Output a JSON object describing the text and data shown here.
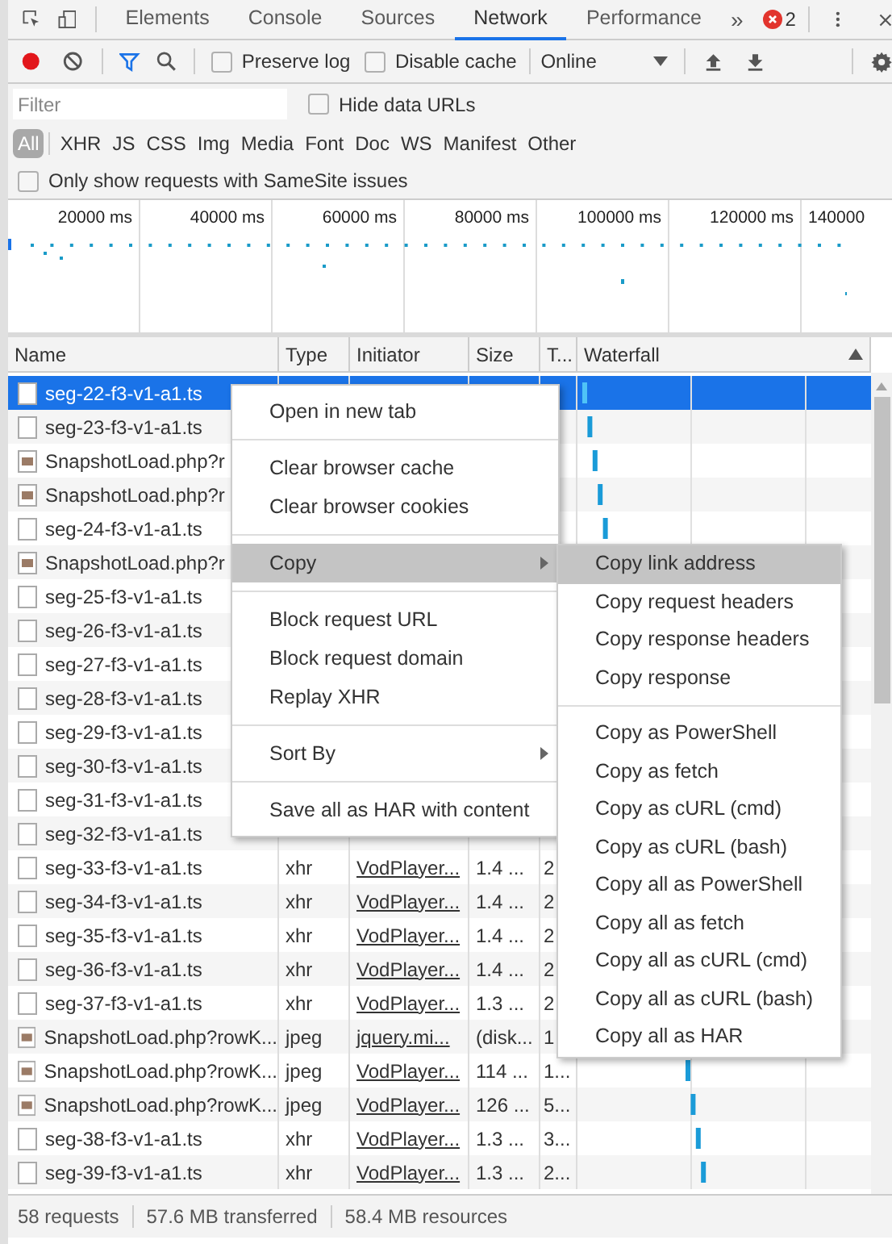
{
  "tabs": [
    {
      "label": "Elements",
      "selected": false
    },
    {
      "label": "Console",
      "selected": false
    },
    {
      "label": "Sources",
      "selected": false
    },
    {
      "label": "Network",
      "selected": true
    },
    {
      "label": "Performance",
      "selected": false
    }
  ],
  "more_tabs": "»",
  "error_count": "2",
  "toolbar": {
    "recording": true,
    "preserve_log": {
      "label": "Preserve log",
      "checked": false
    },
    "disable_cache": {
      "label": "Disable cache",
      "checked": false
    },
    "throttling": "Online"
  },
  "filter": {
    "placeholder": "Filter",
    "hide_data_urls": {
      "label": "Hide data URLs",
      "checked": false
    }
  },
  "type_filters": [
    {
      "label": "All",
      "selected": true
    },
    {
      "label": "XHR",
      "selected": false
    },
    {
      "label": "JS",
      "selected": false
    },
    {
      "label": "CSS",
      "selected": false
    },
    {
      "label": "Img",
      "selected": false
    },
    {
      "label": "Media",
      "selected": false
    },
    {
      "label": "Font",
      "selected": false
    },
    {
      "label": "Doc",
      "selected": false
    },
    {
      "label": "WS",
      "selected": false
    },
    {
      "label": "Manifest",
      "selected": false
    },
    {
      "label": "Other",
      "selected": false
    }
  ],
  "samesite": {
    "label": "Only show requests with SameSite issues",
    "checked": false
  },
  "timeline_ticks": [
    "20000 ms",
    "40000 ms",
    "60000 ms",
    "80000 ms",
    "100000 ms",
    "120000 ms",
    "140000"
  ],
  "columns": [
    "Name",
    "Type",
    "Initiator",
    "Size",
    "T...",
    "Waterfall"
  ],
  "rows": [
    {
      "name": "seg-22-f3-v1-a1.ts",
      "kind": "doc",
      "selected": true,
      "waterfall": true
    },
    {
      "name": "seg-23-f3-v1-a1.ts",
      "kind": "doc",
      "selected": false,
      "waterfall": true
    },
    {
      "name": "SnapshotLoad.php?r",
      "kind": "image",
      "selected": false,
      "waterfall": true
    },
    {
      "name": "SnapshotLoad.php?r",
      "kind": "image",
      "selected": false,
      "waterfall": true
    },
    {
      "name": "seg-24-f3-v1-a1.ts",
      "kind": "doc",
      "selected": false,
      "waterfall": true
    },
    {
      "name": "SnapshotLoad.php?r",
      "kind": "image",
      "selected": false,
      "waterfall": false
    },
    {
      "name": "seg-25-f3-v1-a1.ts",
      "kind": "doc",
      "selected": false,
      "waterfall": false
    },
    {
      "name": "seg-26-f3-v1-a1.ts",
      "kind": "doc",
      "selected": false,
      "waterfall": false
    },
    {
      "name": "seg-27-f3-v1-a1.ts",
      "kind": "doc",
      "selected": false,
      "waterfall": false
    },
    {
      "name": "seg-28-f3-v1-a1.ts",
      "kind": "doc",
      "selected": false,
      "waterfall": false
    },
    {
      "name": "seg-29-f3-v1-a1.ts",
      "kind": "doc",
      "selected": false,
      "waterfall": false
    },
    {
      "name": "seg-30-f3-v1-a1.ts",
      "kind": "doc",
      "selected": false,
      "waterfall": false
    },
    {
      "name": "seg-31-f3-v1-a1.ts",
      "kind": "doc",
      "selected": false,
      "waterfall": false
    },
    {
      "name": "seg-32-f3-v1-a1.ts",
      "kind": "doc",
      "selected": false,
      "waterfall": false
    },
    {
      "name": "seg-33-f3-v1-a1.ts",
      "type": "xhr",
      "initiator": "VodPlayer...",
      "size": "1.4 ...",
      "time": "2",
      "kind": "doc",
      "selected": false,
      "waterfall": false
    },
    {
      "name": "seg-34-f3-v1-a1.ts",
      "type": "xhr",
      "initiator": "VodPlayer...",
      "size": "1.4 ...",
      "time": "2",
      "kind": "doc",
      "selected": false,
      "waterfall": false
    },
    {
      "name": "seg-35-f3-v1-a1.ts",
      "type": "xhr",
      "initiator": "VodPlayer...",
      "size": "1.4 ...",
      "time": "2",
      "kind": "doc",
      "selected": false,
      "waterfall": false
    },
    {
      "name": "seg-36-f3-v1-a1.ts",
      "type": "xhr",
      "initiator": "VodPlayer...",
      "size": "1.4 ...",
      "time": "2",
      "kind": "doc",
      "selected": false,
      "waterfall": false
    },
    {
      "name": "seg-37-f3-v1-a1.ts",
      "type": "xhr",
      "initiator": "VodPlayer...",
      "size": "1.3 ...",
      "time": "2",
      "kind": "doc",
      "selected": false,
      "waterfall": false
    },
    {
      "name": "SnapshotLoad.php?rowK...",
      "type": "jpeg",
      "initiator": "jquery.mi...",
      "size": "(disk...",
      "time": "1",
      "kind": "image",
      "selected": false,
      "waterfall": false
    },
    {
      "name": "SnapshotLoad.php?rowK...",
      "type": "jpeg",
      "initiator": "VodPlayer...",
      "size": "114 ...",
      "time": "1...",
      "kind": "image",
      "selected": false,
      "waterfall": true
    },
    {
      "name": "SnapshotLoad.php?rowK...",
      "type": "jpeg",
      "initiator": "VodPlayer...",
      "size": "126 ...",
      "time": "5...",
      "kind": "image",
      "selected": false,
      "waterfall": true
    },
    {
      "name": "seg-38-f3-v1-a1.ts",
      "type": "xhr",
      "initiator": "VodPlayer...",
      "size": "1.3 ...",
      "time": "3...",
      "kind": "doc",
      "selected": false,
      "waterfall": true
    },
    {
      "name": "seg-39-f3-v1-a1.ts",
      "type": "xhr",
      "initiator": "VodPlayer...",
      "size": "1.3 ...",
      "time": "2...",
      "kind": "doc",
      "selected": false,
      "waterfall": true
    }
  ],
  "status": [
    "58 requests",
    "57.6 MB transferred",
    "58.4 MB resources"
  ],
  "context_menu": [
    [
      {
        "label": "Open in new tab",
        "selected": false,
        "submenu": false
      }
    ],
    [
      {
        "label": "Clear browser cache",
        "selected": false,
        "submenu": false
      },
      {
        "label": "Clear browser cookies",
        "selected": false,
        "submenu": false
      }
    ],
    [
      {
        "label": "Copy",
        "selected": true,
        "submenu": true
      }
    ],
    [
      {
        "label": "Block request URL",
        "selected": false,
        "submenu": false
      },
      {
        "label": "Block request domain",
        "selected": false,
        "submenu": false
      },
      {
        "label": "Replay XHR",
        "selected": false,
        "submenu": false
      }
    ],
    [
      {
        "label": "Sort By",
        "selected": false,
        "submenu": true
      }
    ],
    [
      {
        "label": "Save all as HAR with content",
        "selected": false,
        "submenu": false
      }
    ]
  ],
  "copy_submenu": [
    [
      {
        "label": "Copy link address",
        "selected": true
      },
      {
        "label": "Copy request headers",
        "selected": false
      },
      {
        "label": "Copy response headers",
        "selected": false
      },
      {
        "label": "Copy response",
        "selected": false
      }
    ],
    [
      {
        "label": "Copy as PowerShell",
        "selected": false
      },
      {
        "label": "Copy as fetch",
        "selected": false
      },
      {
        "label": "Copy as cURL (cmd)",
        "selected": false
      },
      {
        "label": "Copy as cURL (bash)",
        "selected": false
      },
      {
        "label": "Copy all as PowerShell",
        "selected": false
      },
      {
        "label": "Copy all as fetch",
        "selected": false
      },
      {
        "label": "Copy all as cURL (cmd)",
        "selected": false
      },
      {
        "label": "Copy all as cURL (bash)",
        "selected": false
      },
      {
        "label": "Copy all as HAR",
        "selected": false
      }
    ]
  ]
}
